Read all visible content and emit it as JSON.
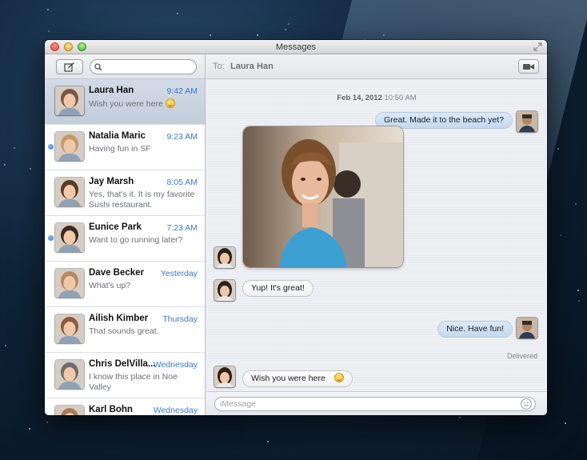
{
  "window": {
    "title": "Messages"
  },
  "sidebar": {
    "search": {
      "placeholder": ""
    },
    "conversations": [
      {
        "name": "Laura Han",
        "time": "9:42 AM",
        "preview": "Wish you were here",
        "selected": true,
        "unread": false,
        "avatar_color": "#7a5642"
      },
      {
        "name": "Natalia Maric",
        "time": "9:23 AM",
        "preview": "Having fun in SF",
        "selected": false,
        "unread": true,
        "avatar_color": "#c49a6c"
      },
      {
        "name": "Jay Marsh",
        "time": "8:05 AM",
        "preview": "Yes, that's it. It is my favorite Sushi restaurant.",
        "selected": false,
        "unread": false,
        "avatar_color": "#5b3a27"
      },
      {
        "name": "Eunice Park",
        "time": "7:23 AM",
        "preview": "Want to go running later?",
        "selected": false,
        "unread": true,
        "avatar_color": "#3a2a22"
      },
      {
        "name": "Dave Becker",
        "time": "Yesterday",
        "preview": "What's up?",
        "selected": false,
        "unread": false,
        "avatar_color": "#b58b64"
      },
      {
        "name": "Ailish Kimber",
        "time": "Thursday",
        "preview": "That sounds great.",
        "selected": false,
        "unread": false,
        "avatar_color": "#8c5a3c"
      },
      {
        "name": "Chris DelVilla...",
        "time": "Wednesday",
        "preview": "I know this place in Noe Valley",
        "selected": false,
        "unread": false,
        "avatar_color": "#6e6e6e"
      },
      {
        "name": "Karl Bohn",
        "time": "Wednesday",
        "preview": "",
        "selected": false,
        "unread": false,
        "avatar_color": "#a37d5b"
      }
    ]
  },
  "main": {
    "to_label": "To:",
    "recipient": "Laura Han",
    "timestamp": {
      "date": "Feb 14, 2012",
      "time": "10:50 AM"
    },
    "messages": [
      {
        "from": "me",
        "text": "Great. Made it to the beach yet?"
      },
      {
        "from": "them",
        "type": "photo"
      },
      {
        "from": "them",
        "text": "Yup! It's great!"
      },
      {
        "from": "me",
        "text": "Nice. Have fun!"
      },
      {
        "from": "them",
        "text": "Wish you were here"
      },
      {
        "from": "them",
        "type": "typing"
      }
    ],
    "delivered": "Delivered",
    "input": {
      "placeholder": "iMessage"
    }
  }
}
